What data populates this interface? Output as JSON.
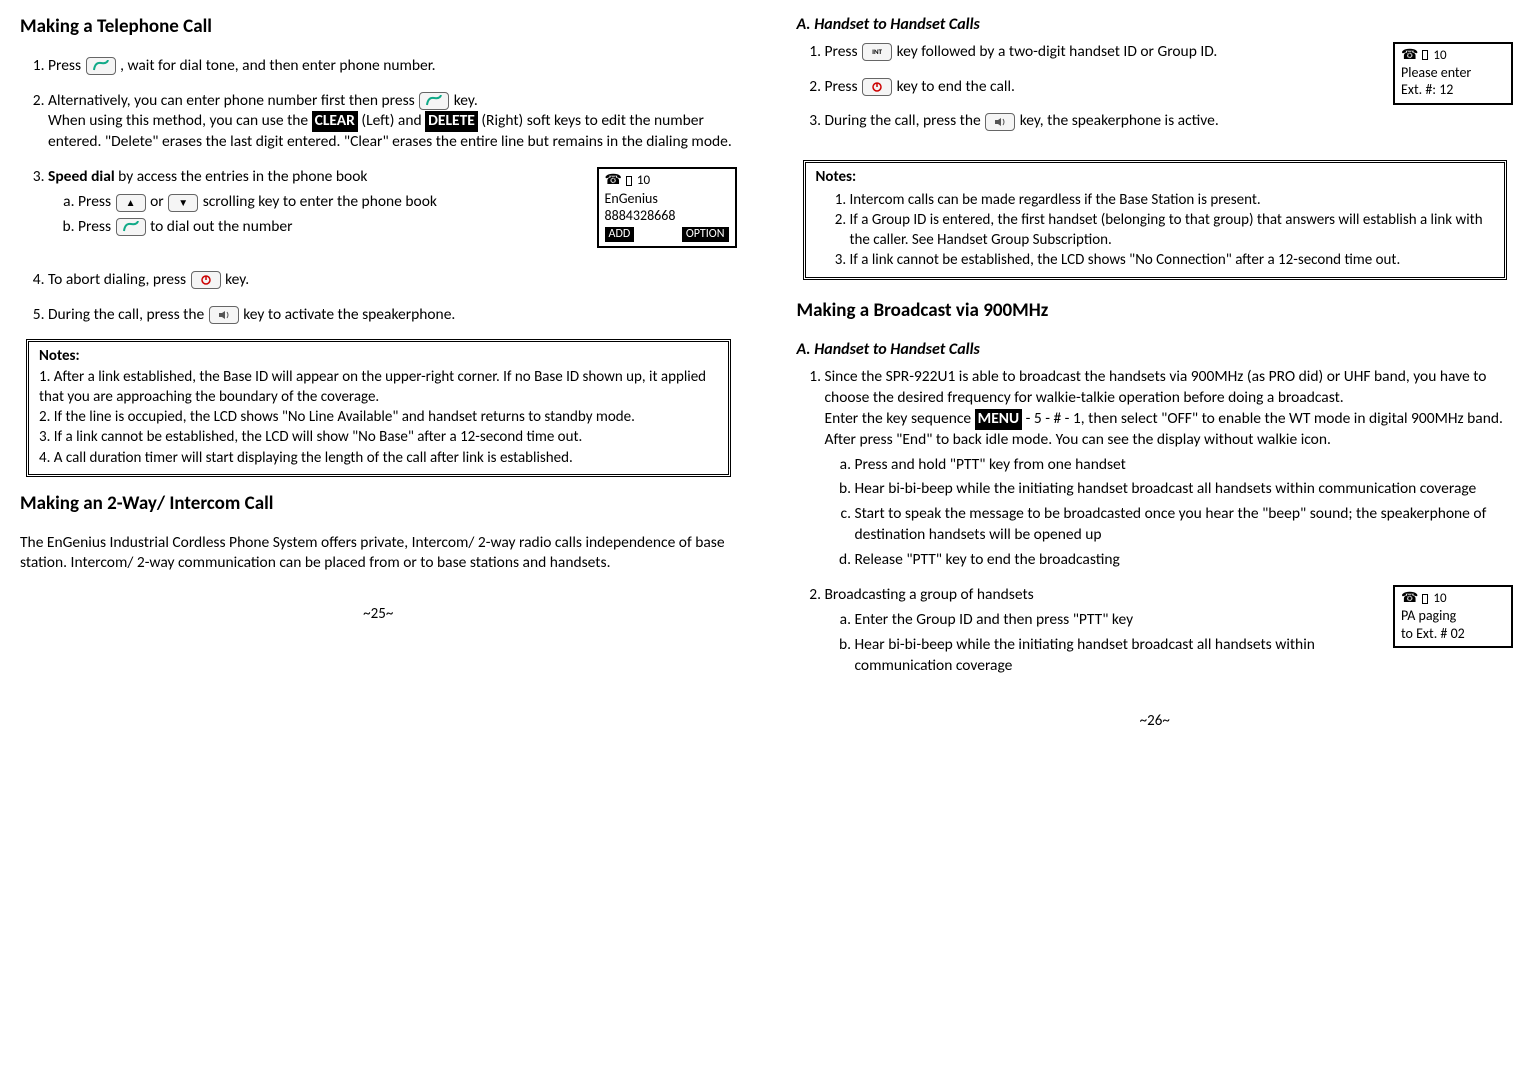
{
  "left": {
    "h_call": "Making a Telephone Call",
    "h_intercom": "Making an 2-Way/ Intercom Call",
    "step1": "Press ",
    "step1b": ", wait for dial tone, and then enter phone number.",
    "step2a": "Alternatively, you can enter phone number first then press ",
    "step2b": " key.",
    "step2c": "When using this method, you can use the ",
    "key_clear": "CLEAR",
    "step2c_mid": " (Left) and ",
    "key_delete": "DELETE",
    "step2d": " (Right) soft keys to edit the number entered.  \"Delete\" erases the last digit entered. \"Clear\" erases the entire line but remains in the dialing mode.",
    "step3_lead": "Speed dial",
    "step3_tail": " by access the entries in the phone book",
    "step3a_a": "Press ",
    "step3a_b": " or ",
    "step3a_c": " scrolling key to enter the phone book",
    "step3b_a": "Press ",
    "step3b_b": " to dial out the number",
    "step4a": "To abort dialing, press ",
    "step4b": " key.",
    "step5a": "During the call, press  the ",
    "step5b": " key to activate the speakerphone.",
    "lcd1": {
      "id": "10",
      "l1": "EnGenius",
      "l2": "8884328668",
      "sk1": "ADD",
      "sk2": "OPTION"
    },
    "notes_title": "Notes:",
    "note1": "1. After a link established, the Base ID will appear on the upper-right corner. If no Base ID shown up, it applied that you are approaching the boundary of the coverage.",
    "note2": "2. If the line is occupied, the LCD shows \"No Line Available\" and handset returns to standby mode.",
    "note3": "3. If a link cannot be established, the LCD will show \"No Base\" after a 12-second time out.",
    "note4": "4. A call duration timer will start displaying the length of the call after link is established.",
    "intercom_p": "The EnGenius Industrial Cordless Phone System offers private, Intercom/ 2-way radio calls independence of base station.  Intercom/ 2-way communication can be placed from or to base stations and handsets.",
    "pagenum": "~25~"
  },
  "right": {
    "h_A": "A. Handset to Handset Calls",
    "r1a": "Press ",
    "r1b": " key followed by a two-digit handset ID or Group ID.",
    "r2a": "Press ",
    "r2b": " key to end the call.",
    "r3a": "During the call, press  the ",
    "r3b": " key, the speakerphone is active.",
    "lcd_ext": {
      "id": "10",
      "l1": "Please enter",
      "l2": "Ext. #: 12"
    },
    "notes_title": "Notes:",
    "rn1": "Intercom calls can be made regardless if the Base Station is present.",
    "rn2": "If a Group ID is entered, the first handset (belonging to that group) that answers will establish a link with the caller.  See Handset Group Subscription.",
    "rn3": "If a link cannot be established, the LCD shows \"No Connection\" after a 12-second time out.",
    "h_broadcast": "Making a Broadcast via 900MHz",
    "h_A2": "A.  Handset to Handset Calls",
    "b1_p1": "Since the SPR-922U1 is able to broadcast the handsets via 900MHz (as PRO did) or UHF band, you have to choose the desired frequency for walkie-talkie operation before doing a broadcast.",
    "b1_p2a": "Enter the key sequence ",
    "key_menu": "MENU",
    "b1_p2b": " - 5 - # - 1, then select \"OFF\" to enable the WT mode in digital 900MHz band.",
    "b1_p3": "After press \"End\" to back idle mode. You can see the display without walkie icon.",
    "b1a": "Press and hold  \"PTT\" key from one handset",
    "b1b": "Hear bi-bi-beep while the initiating handset broadcast all handsets within communication coverage",
    "b1c": "Start to speak the message to be broadcasted once you hear the \"beep\" sound; the speakerphone of destination handsets will be opened up",
    "b1d": "Release \"PTT\" key to end the broadcasting",
    "b2_lead": "Broadcasting a group of handsets",
    "b2a_a": "Enter the Group ID and then press  ",
    "ptt": "\"PTT\"",
    "b2a_b": " key",
    "b2b": "Hear bi-bi-beep while the initiating handset broadcast all handsets within communication coverage",
    "lcd_pa": {
      "id": "10",
      "l1": "PA paging",
      "l2": "to Ext. # 02"
    },
    "pagenum": "~26~"
  }
}
